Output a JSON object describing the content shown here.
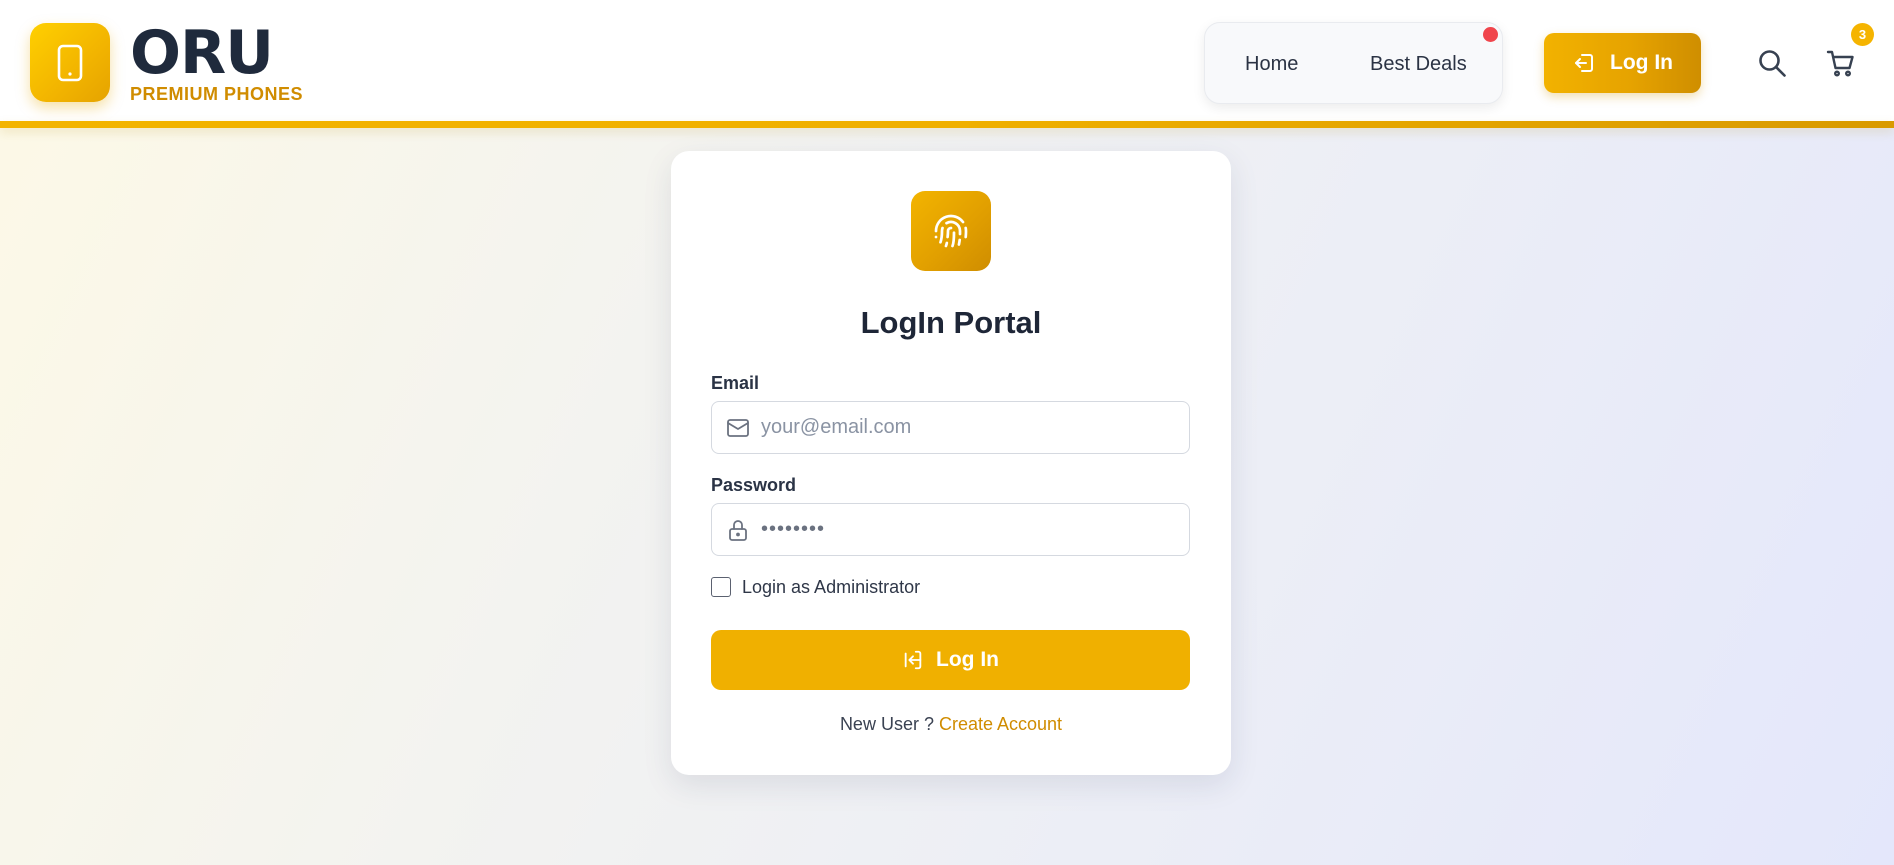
{
  "brand": {
    "name": "ORU",
    "subtitle": "PREMIUM PHONES",
    "logo_icon": "smartphone-icon"
  },
  "nav": {
    "items": [
      {
        "label": "Home"
      },
      {
        "label": "Best Deals"
      }
    ],
    "notification_dot_color": "#f0454c"
  },
  "header_actions": {
    "login_label": "Log In",
    "login_icon": "login-arrow-icon",
    "search_icon": "search-icon",
    "cart_icon": "cart-icon",
    "cart_count": "3"
  },
  "login_form": {
    "icon": "fingerprint-icon",
    "title": "LogIn Portal",
    "email_label": "Email",
    "email_placeholder": "your@email.com",
    "email_value": "",
    "password_label": "Password",
    "password_value": "••••••••",
    "admin_checkbox_label": "Login as Administrator",
    "admin_checked": false,
    "submit_label": "Log In",
    "new_user_text": "New User ?",
    "create_account_label": "Create Account"
  },
  "colors": {
    "accent": "#f0b000",
    "accent_dark": "#d08c00",
    "text_dark": "#1e2637"
  }
}
